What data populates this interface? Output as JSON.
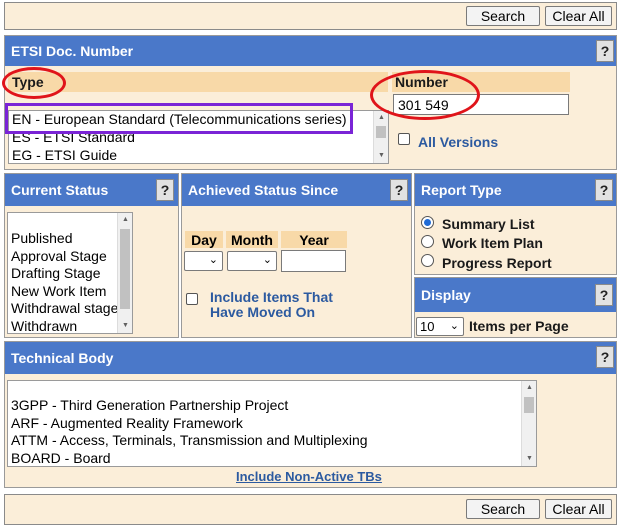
{
  "toolbar": {
    "search_label": "Search",
    "clear_all_label": "Clear All"
  },
  "etsi_doc": {
    "header": "ETSI Doc. Number",
    "help": "?",
    "type_label": "Type",
    "type_options": [
      "EN - European Standard (Telecommunications series)",
      "ES - ETSI Standard",
      "EG - ETSI Guide"
    ],
    "number_label": "Number",
    "number_value": "301 549",
    "all_versions_label": "All Versions"
  },
  "current_status": {
    "header": "Current Status",
    "help": "?",
    "options": [
      "",
      "Published",
      "Approval Stage",
      "Drafting Stage",
      "New Work Item",
      "Withdrawal stage",
      "Withdrawn"
    ]
  },
  "achieved_status": {
    "header": "Achieved Status Since",
    "help": "?",
    "day_label": "Day",
    "month_label": "Month",
    "year_label": "Year",
    "include_moved_label_1": "Include Items That",
    "include_moved_label_2": "Have Moved On"
  },
  "report_type": {
    "header": "Report Type",
    "help": "?",
    "options": [
      "Summary List",
      "Work Item Plan",
      "Progress Report"
    ],
    "selected": "Summary List"
  },
  "display": {
    "header": "Display",
    "help": "?",
    "per_page_value": "10",
    "per_page_label": "Items per Page"
  },
  "technical_body": {
    "header": "Technical Body",
    "help": "?",
    "options": [
      "",
      "3GPP - Third Generation Partnership Project",
      "ARF - Augmented Reality Framework",
      "ATTM - Access, Terminals, Transmission and Multiplexing",
      "BOARD - Board"
    ],
    "include_nonactive_label": "Include Non-Active TBs"
  },
  "colors": {
    "header_blue": "#4a78c9",
    "panel_bg": "#fbeed9",
    "annotation_red": "#e0141a",
    "annotation_purple": "#7a24d6"
  }
}
